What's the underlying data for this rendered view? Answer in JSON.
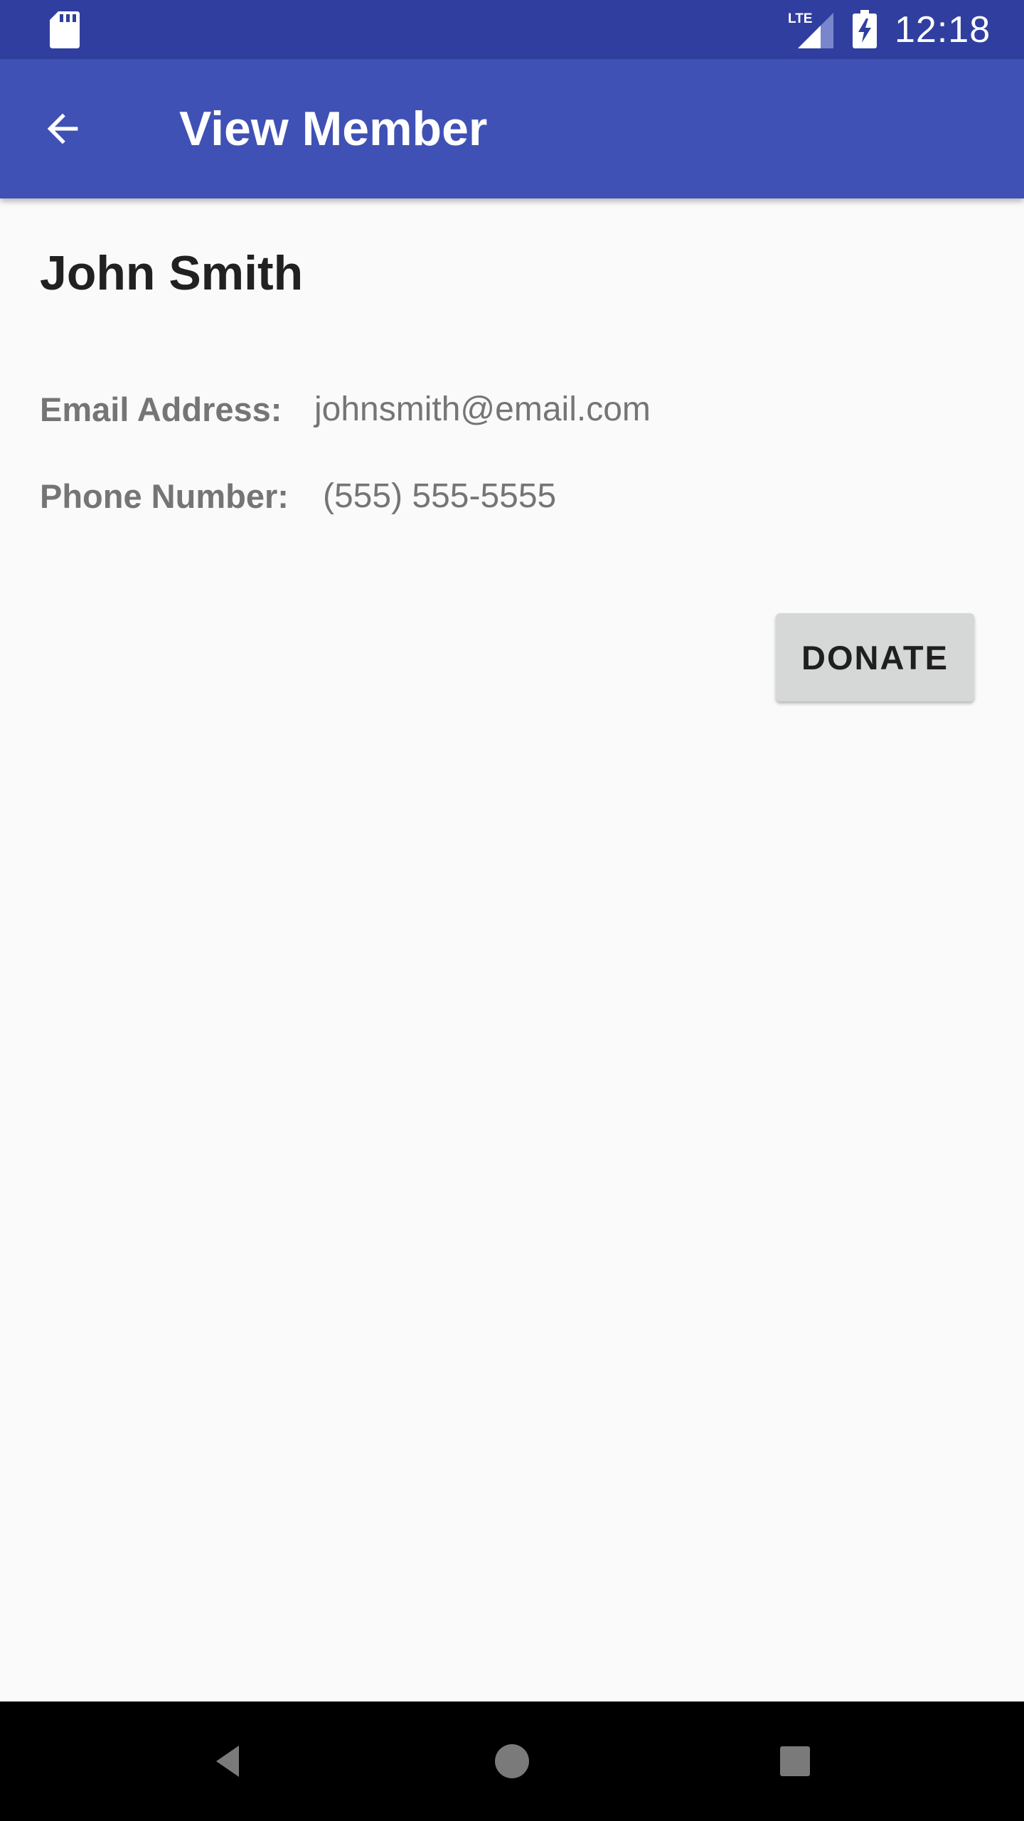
{
  "status_bar": {
    "time": "12:18",
    "network_label": "LTE",
    "icons": [
      "sd-card-icon",
      "lte-signal-icon",
      "battery-charging-icon"
    ]
  },
  "app_bar": {
    "title": "View Member",
    "back_icon": "arrow-back-icon"
  },
  "member": {
    "name": "John Smith",
    "email_label": "Email Address:",
    "email_value": "johnsmith@email.com",
    "phone_label": "Phone Number:",
    "phone_value": "(555) 555-5555"
  },
  "actions": {
    "donate_label": "DONATE"
  },
  "nav_bar": {
    "icons": [
      "back-triangle-icon",
      "home-circle-icon",
      "recents-square-icon"
    ]
  },
  "colors": {
    "status_bar": "#303f9f",
    "app_bar": "#3f51b5",
    "background": "#fafafa",
    "button": "#d6d7d7"
  }
}
